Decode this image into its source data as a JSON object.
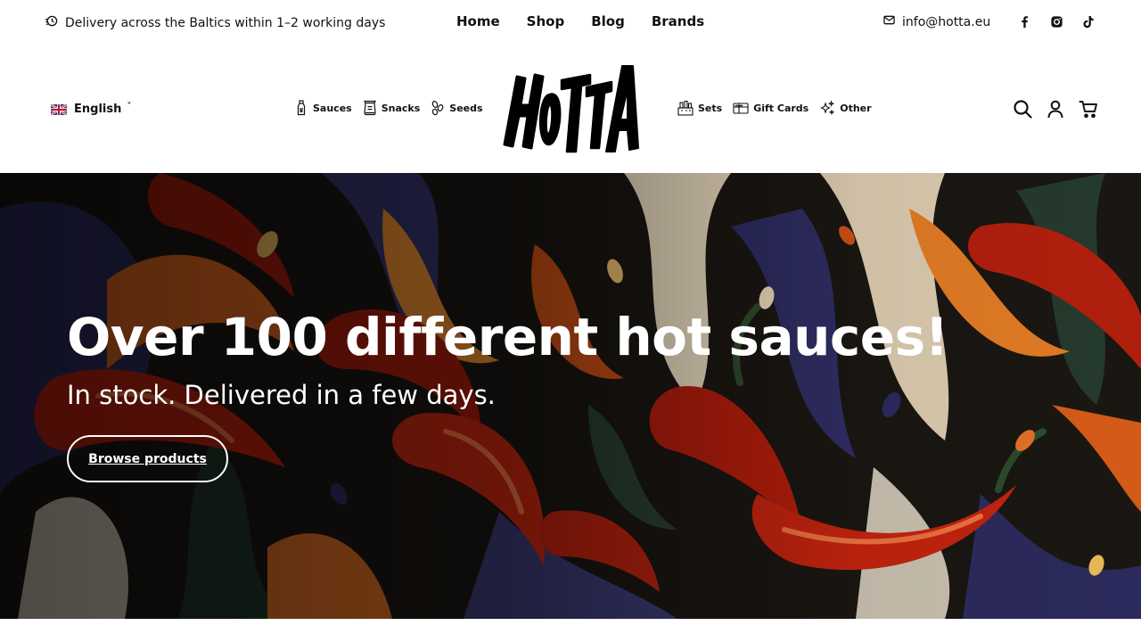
{
  "topbar": {
    "delivery_text": "Delivery across the Baltics within 1–2 working days",
    "nav": [
      "Home",
      "Shop",
      "Blog",
      "Brands"
    ],
    "email": "info@hotta.eu",
    "social_icons": [
      "facebook-icon",
      "instagram-icon",
      "tiktok-icon"
    ]
  },
  "header": {
    "language": "English",
    "categories_left": [
      "Sauces",
      "Snacks",
      "Seeds"
    ],
    "categories_right": [
      "Sets",
      "Gift Cards",
      "Other"
    ],
    "logo_text": "HOTTA",
    "action_icons": [
      "search-icon",
      "account-icon",
      "cart-icon"
    ]
  },
  "hero": {
    "title": "Over 100 different hot sauces!",
    "subtitle": "In stock. Delivered in a few days.",
    "button_label": "Browse products"
  },
  "colors": {
    "text": "#111111",
    "hero_text": "#ffffff",
    "pepper_red": "#b8200e",
    "pepper_orange": "#e06a1c",
    "navy": "#2c2a5e",
    "cream": "#e8dcc4",
    "dark_green": "#1f3326"
  }
}
